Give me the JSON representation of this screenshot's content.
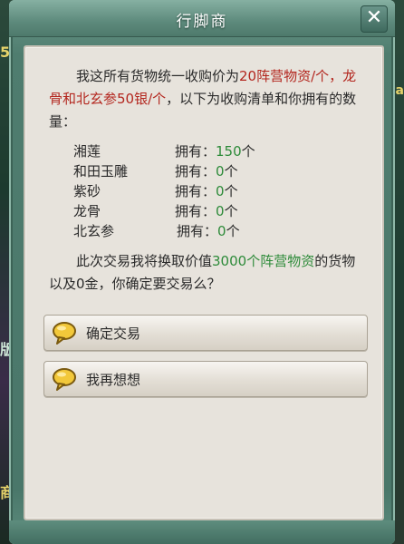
{
  "dialog": {
    "title": "行脚商",
    "close_icon": "close-icon"
  },
  "edge_glyphs": {
    "left_top": "5",
    "right_top": "a",
    "left_mid": "版",
    "left_bottom": "商"
  },
  "intro": {
    "part1": "我这所有货物统一收购价为",
    "part2_red": "20阵营物资/个，龙骨和北玄参50银/个",
    "part3": "，以下为收购清单和你拥有的数量："
  },
  "items": [
    {
      "name": "湘莲",
      "own_label": "拥有：",
      "count": "150",
      "unit": "个"
    },
    {
      "name": "和田玉雕",
      "own_label": "拥有：",
      "count": "0",
      "unit": "个"
    },
    {
      "name": "紫砂",
      "own_label": "拥有：",
      "count": "0",
      "unit": "个"
    },
    {
      "name": "龙骨",
      "own_label": "拥有：",
      "count": "0",
      "unit": "个"
    },
    {
      "name": "北玄参",
      "own_label": "拥有：",
      "count": "0",
      "unit": "个"
    }
  ],
  "confirm": {
    "part1": "此次交易我将换取价值",
    "part2_green": "3000个阵营物资",
    "part3": "的货物以及0金，你确定要交易么？"
  },
  "buttons": {
    "confirm_label": "确定交易",
    "reconsider_label": "我再想想",
    "icon": "speech-bubble-icon"
  }
}
